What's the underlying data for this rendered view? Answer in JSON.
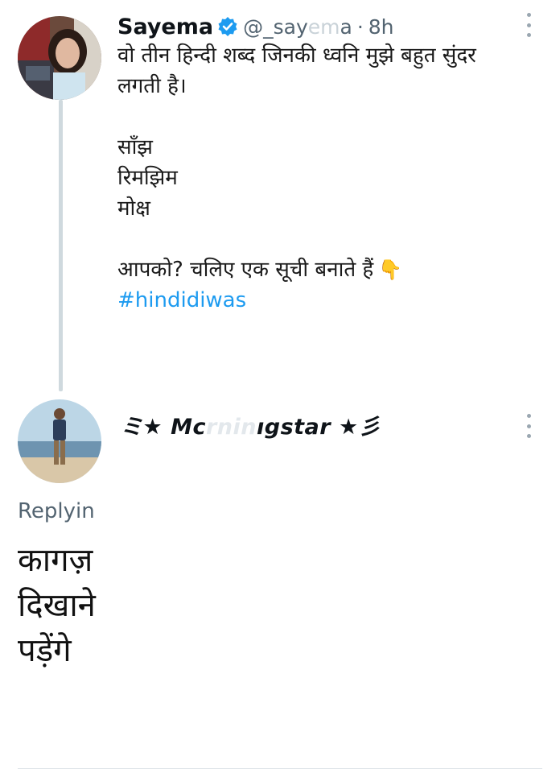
{
  "tweet": {
    "author_name": "Sayema",
    "handle_visible": "@_say",
    "handle_faded": "em",
    "handle_end": "a",
    "separator": "·",
    "time": "8h",
    "lines": [
      "वो तीन हिन्दी शब्द जिनकी ध्वनि मुझे बहुत सुंदर",
      "लगती है।",
      "",
      "साँझ",
      "रिमझिम",
      "मोक्ष",
      "",
      "आपको? चलिए एक सूची बनाते हैं"
    ],
    "hand_emoji": "👇",
    "hashtag": "#hindidiwas",
    "verified_icon": "verified-badge-icon",
    "accent_color": "#1d9bf0"
  },
  "reply": {
    "author_prefix": "ミ★ Mc",
    "author_faded": "rnin",
    "author_suffix": "ıgstar ★彡",
    "replying_label": "Replyin",
    "lines": [
      "कागज़",
      "दिखाने",
      "पड़ेंगे"
    ]
  }
}
